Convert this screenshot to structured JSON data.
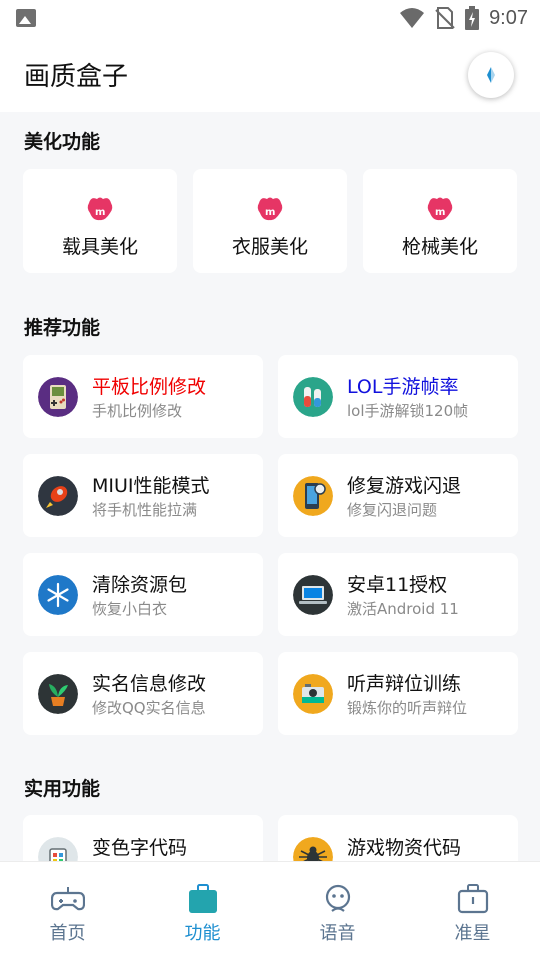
{
  "status_bar": {
    "time": "9:07"
  },
  "app": {
    "title": "画质盒子"
  },
  "sections": {
    "beautify": {
      "title": "美化功能",
      "items": [
        {
          "label": "载具美化",
          "icon": "pink-m-icon"
        },
        {
          "label": "衣服美化",
          "icon": "pink-m-icon"
        },
        {
          "label": "枪械美化",
          "icon": "pink-m-icon"
        }
      ]
    },
    "recommended": {
      "title": "推荐功能",
      "items": [
        {
          "title": "平板比例修改",
          "subtitle": "手机比例修改",
          "title_color": "#f00000",
          "icon": "gameboy-icon"
        },
        {
          "title": "LOL手游帧率",
          "subtitle": "lol手游解锁120帧",
          "title_color": "#1111dd",
          "icon": "potion-icon"
        },
        {
          "title": "MIUI性能模式",
          "subtitle": "将手机性能拉满",
          "title_color": "#111111",
          "icon": "rocket-icon"
        },
        {
          "title": "修复游戏闪退",
          "subtitle": "修复闪退问题",
          "title_color": "#111111",
          "icon": "phone-repair-icon"
        },
        {
          "title": "清除资源包",
          "subtitle": "恢复小白衣",
          "title_color": "#111111",
          "icon": "snowflake-icon"
        },
        {
          "title": "安卓11授权",
          "subtitle": "激活Android 11",
          "title_color": "#111111",
          "icon": "laptop-icon"
        },
        {
          "title": "实名信息修改",
          "subtitle": "修改QQ实名信息",
          "title_color": "#111111",
          "icon": "plant-icon"
        },
        {
          "title": "听声辩位训练",
          "subtitle": "锻炼你的听声辩位",
          "title_color": "#111111",
          "icon": "camera-icon"
        }
      ]
    },
    "utility": {
      "title": "实用功能",
      "items": [
        {
          "title": "变色字代码",
          "icon": "color-palette-icon"
        },
        {
          "title": "游戏物资代码",
          "icon": "spider-icon"
        }
      ]
    }
  },
  "bottom_nav": {
    "items": [
      {
        "label": "首页",
        "icon": "gamepad-icon",
        "active": false
      },
      {
        "label": "功能",
        "icon": "toolbox-icon",
        "active": true
      },
      {
        "label": "语音",
        "icon": "robot-face-icon",
        "active": false
      },
      {
        "label": "准星",
        "icon": "briefcase-icon",
        "active": false
      }
    ]
  },
  "colors": {
    "accent": "#1e8fd0",
    "inactive_nav": "#5c7590",
    "highlight_red": "#f00000",
    "highlight_blue": "#1111dd"
  }
}
